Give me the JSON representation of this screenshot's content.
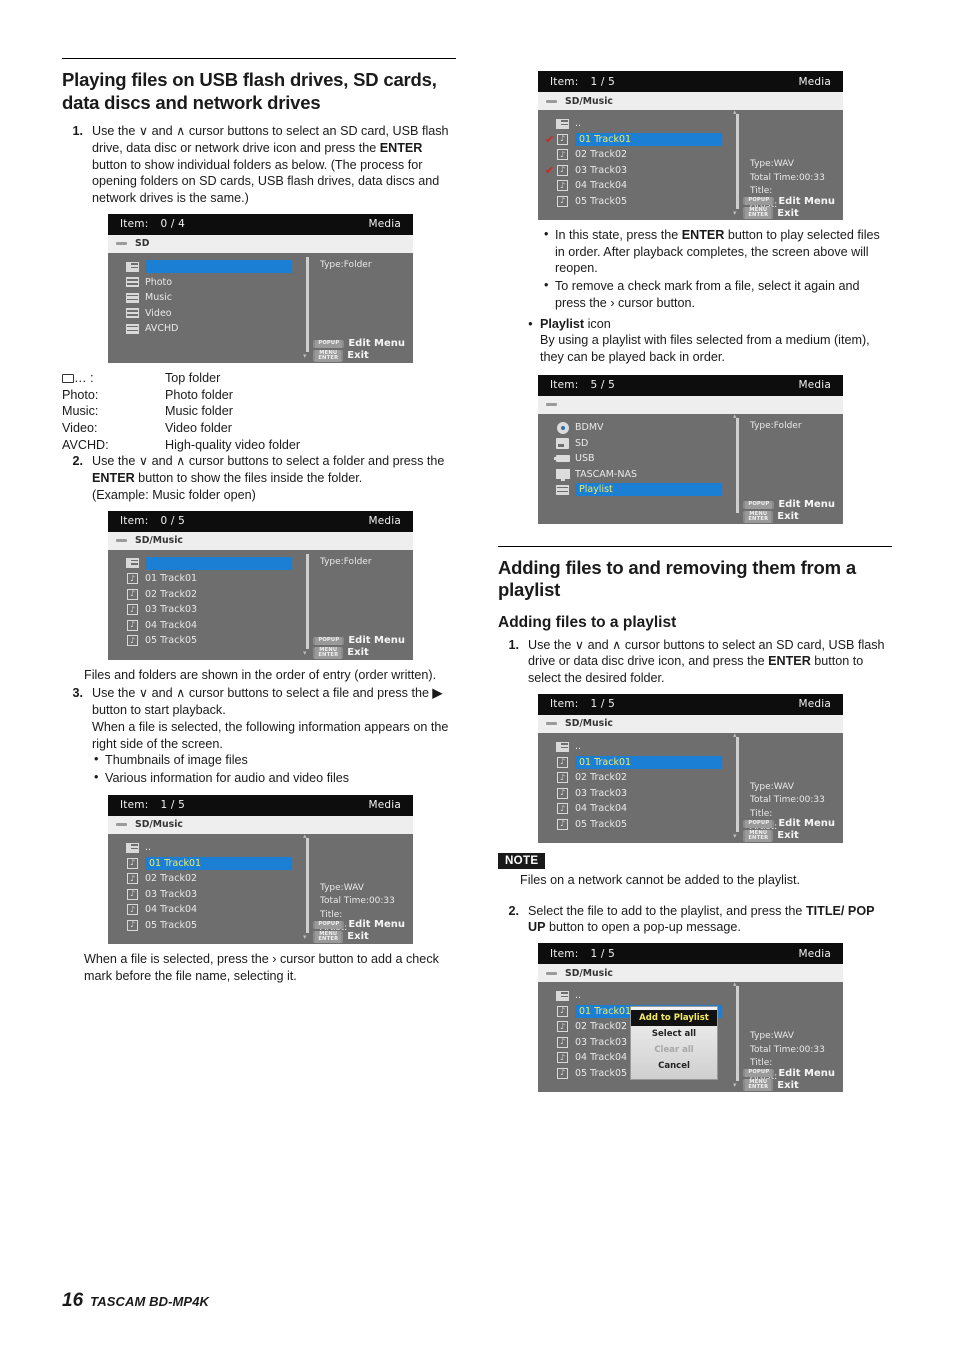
{
  "page": {
    "number": "16",
    "manual": "TASCAM BD-MP4K"
  },
  "left": {
    "heading": "Playing files on USB flash drives, SD cards, data discs and network drives",
    "step1": {
      "num": "1.",
      "text_a": "Use the ",
      "down": "∨",
      "text_b": " and ",
      "up": "∧",
      "text_c": " cursor buttons to select an SD card, USB flash drive, data disc or network drive icon and press the ",
      "bold": "ENTER",
      "text_d": " button to show individual folders as below. (The process for opening folders on SD cards, USB flash drives, data discs and network drives is the same.)"
    },
    "legend": [
      {
        "key": "… :",
        "value": "Top folder",
        "icon": "folder-icon"
      },
      {
        "key": "Photo:",
        "value": "Photo folder"
      },
      {
        "key": "Music:",
        "value": "Music folder"
      },
      {
        "key": "Video:",
        "value": "Video folder"
      },
      {
        "key": "AVCHD:",
        "value": "High-quality video folder"
      }
    ],
    "step2": {
      "num": "2.",
      "text_a": "Use the ",
      "down": "∨",
      "text_b": " and ",
      "up": "∧",
      "text_c": " cursor buttons to select a folder and press the ",
      "bold": "ENTER",
      "text_d": " button to show the files inside the folder.",
      "example": "(Example: Music folder open)"
    },
    "note_order": "Files and folders are shown in the order of entry (order written).",
    "step3": {
      "num": "3.",
      "text_a": "Use the ",
      "down": "∨",
      "text_b": " and ",
      "up": "∧",
      "text_c": " cursor buttons to select a file and press the ",
      "play": "▶",
      "text_d": " button to start playback.",
      "text_e": "When a file is selected, the following information appears on the right side of the screen.",
      "bullets": [
        "Thumbnails of image files",
        "Various information for audio and video files"
      ]
    },
    "checkmark_note": "When a file is selected, press the › cursor button to add a check mark before the file name, selecting it."
  },
  "right": {
    "bullets_top": [
      "In this state, press the ENTER button to play selected files in order. After playback completes, the screen above will reopen.",
      "To remove a check mark from a file, select it again and press the › cursor button."
    ],
    "bullet1_a": "In this state, press the ",
    "bullet1_bold": "ENTER",
    "bullet1_b": " button to play selected files in order. After playback completes, the screen above will reopen.",
    "bullet2_a": "To remove a check mark from a file, select it again and press the ",
    "bullet2_sym": "›",
    "bullet2_b": " cursor button.",
    "playlist_head_bold": "Playlist",
    "playlist_head_rest": " icon",
    "playlist_desc": "By using a playlist with files selected from a medium (item), they can be played back in order.",
    "heading2": "Adding files to and removing them from a playlist",
    "subheading": "Adding files to a playlist",
    "step1": {
      "num": "1.",
      "text_a": "Use the ",
      "down": "∨",
      "text_b": " and ",
      "up": "∧",
      "text_c": " cursor buttons to select an SD card, USB flash drive or data disc drive icon, and press the ",
      "bold": "ENTER",
      "text_d": " button to select the desired folder."
    },
    "note": {
      "badge": "NOTE",
      "text": "Files on a network cannot be added to the playlist."
    },
    "step2": {
      "num": "2.",
      "text_a": "Select the file to add to the playlist, and press the ",
      "bold": "TITLE/ POP UP",
      "text_b": " button to open a pop-up message."
    }
  },
  "screens": {
    "common": {
      "item_label": "Item:",
      "media_label": "Media",
      "foot_edit": "Edit Menu",
      "foot_exit": "Exit",
      "key_popup": "POPUP",
      "key_menu_top": "MENU",
      "key_menu_bot": "ENTER",
      "type_folder": "Type:Folder",
      "type_wav": "Type:WAV",
      "total_time": "Total Time:00:33",
      "title_label": "Title:",
      "artist_label": "Artist:"
    },
    "sd_root": {
      "count": "0 / 4",
      "path": "SD",
      "rows": [
        {
          "name": "..",
          "icon": "folder-up-icon",
          "selected": true
        },
        {
          "name": "Photo",
          "icon": "folder-icon"
        },
        {
          "name": "Music",
          "icon": "folder-icon"
        },
        {
          "name": "Video",
          "icon": "folder-icon"
        },
        {
          "name": "AVCHD",
          "icon": "folder-icon"
        }
      ],
      "info": [
        "Type:Folder"
      ]
    },
    "music_folder": {
      "count": "0 / 5",
      "path": "SD/Music",
      "rows": [
        {
          "name": "..",
          "icon": "folder-up-icon",
          "selected": true
        },
        {
          "name": "01 Track01",
          "icon": "music-icon"
        },
        {
          "name": "02 Track02",
          "icon": "music-icon"
        },
        {
          "name": "03 Track03",
          "icon": "music-icon"
        },
        {
          "name": "04 Track04",
          "icon": "music-icon"
        },
        {
          "name": "05 Track05",
          "icon": "music-icon"
        }
      ],
      "info": [
        "Type:Folder"
      ]
    },
    "track_selected": {
      "count": "1 / 5",
      "path": "SD/Music",
      "rows": [
        {
          "name": "..",
          "icon": "folder-up-icon"
        },
        {
          "name": "01 Track01",
          "icon": "music-icon",
          "selected": true
        },
        {
          "name": "02 Track02",
          "icon": "music-icon"
        },
        {
          "name": "03 Track03",
          "icon": "music-icon"
        },
        {
          "name": "04 Track04",
          "icon": "music-icon"
        },
        {
          "name": "05 Track05",
          "icon": "music-icon"
        }
      ],
      "info": [
        "Type:WAV",
        "Total Time:00:33",
        "Title:",
        "Artist:"
      ]
    },
    "track_checked": {
      "count": "1 / 5",
      "path": "SD/Music",
      "rows": [
        {
          "name": "..",
          "icon": "folder-up-icon"
        },
        {
          "name": "01 Track01",
          "icon": "music-icon",
          "selected": true,
          "checked": true
        },
        {
          "name": "02 Track02",
          "icon": "music-icon"
        },
        {
          "name": "03 Track03",
          "icon": "music-icon",
          "checked": true
        },
        {
          "name": "04 Track04",
          "icon": "music-icon"
        },
        {
          "name": "05 Track05",
          "icon": "music-icon"
        }
      ],
      "info": [
        "Type:WAV",
        "Total Time:00:33",
        "Title:",
        "Artist:"
      ],
      "check_glyph": "✔"
    },
    "playlist_root": {
      "count": "5 / 5",
      "path": "",
      "rows": [
        {
          "name": "BDMV",
          "icon": "disc-icon"
        },
        {
          "name": "SD",
          "icon": "sd-card-icon"
        },
        {
          "name": "USB",
          "icon": "usb-icon"
        },
        {
          "name": "TASCAM-NAS",
          "icon": "nas-icon"
        },
        {
          "name": "Playlist",
          "icon": "folder-icon",
          "selected": true
        }
      ],
      "info": [
        "Type:Folder"
      ]
    },
    "popup_screen": {
      "count": "1 / 5",
      "path": "SD/Music",
      "rows": [
        {
          "name": "..",
          "icon": "folder-up-icon"
        },
        {
          "name": "01 Track01",
          "icon": "music-icon",
          "selected": true
        },
        {
          "name": "02 Track02",
          "icon": "music-icon"
        },
        {
          "name": "03 Track03",
          "icon": "music-icon"
        },
        {
          "name": "04 Track04",
          "icon": "music-icon"
        },
        {
          "name": "05 Track05",
          "icon": "music-icon"
        }
      ],
      "info": [
        "Type:WAV",
        "Total Time:00:33",
        "Title:",
        "Artist:"
      ],
      "popup_items": [
        {
          "label": "Add to Playlist",
          "state": "selected"
        },
        {
          "label": "Select all",
          "state": "normal"
        },
        {
          "label": "Clear all",
          "state": "disabled"
        },
        {
          "label": "Cancel",
          "state": "normal"
        }
      ]
    }
  },
  "colors": {
    "highlight_blue": "#1b7fd4",
    "highlight_text": "#f3e96a",
    "screen_bg": "#6e6e6e",
    "title_bar": "#0d0d0d",
    "path_bar": "#eeeeee",
    "check_red": "#d8231e"
  }
}
